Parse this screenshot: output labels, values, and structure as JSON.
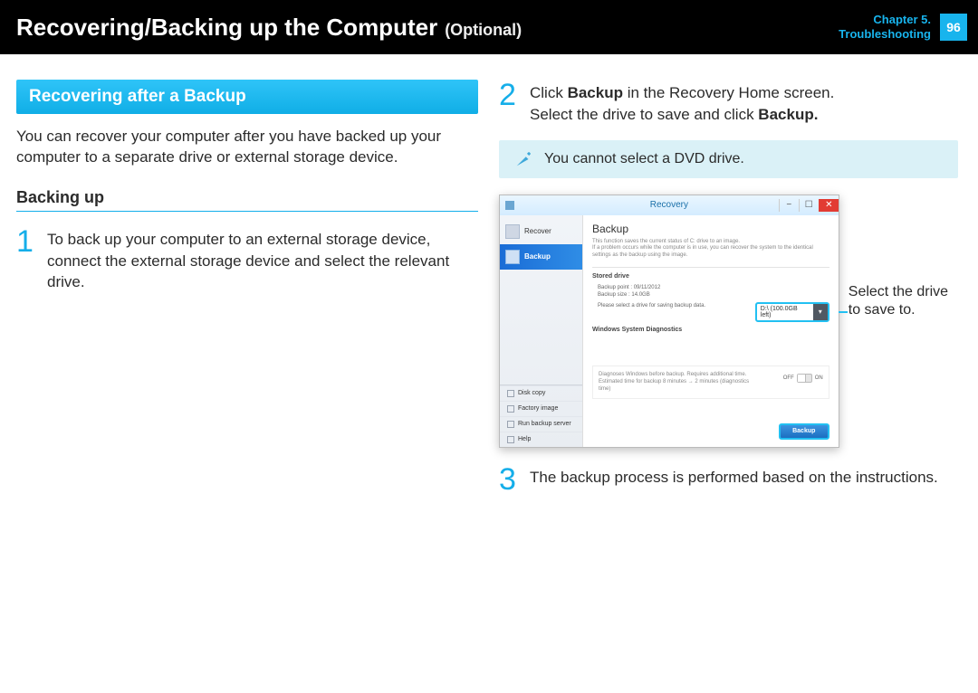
{
  "header": {
    "title_main": "Recovering/Backing up the Computer",
    "title_optional": "(Optional)",
    "chapter_line1": "Chapter 5.",
    "chapter_line2": "Troubleshooting",
    "page_number": "96"
  },
  "left": {
    "section_bar": "Recovering after a Backup",
    "intro": "You can recover your computer after you have backed up your computer to a separate drive or external storage device.",
    "subhead": "Backing up",
    "step1_num": "1",
    "step1_text": "To back up your computer to an external storage device, connect the external storage device and select the relevant drive."
  },
  "right": {
    "step2_num": "2",
    "step2_text_pre": "Click ",
    "step2_text_b1": "Backup",
    "step2_text_mid": " in the Recovery Home screen.\nSelect the drive to save and click ",
    "step2_text_b2": "Backup.",
    "note_text": "You cannot select a DVD drive.",
    "callout_label": "Select the drive to save to.",
    "step3_num": "3",
    "step3_text": "The backup process is performed based on the instructions."
  },
  "app": {
    "titlebar": "Recovery",
    "sidebar": {
      "items": [
        {
          "label": "Recover",
          "selected": false
        },
        {
          "label": "Backup",
          "selected": true
        }
      ],
      "bottom": [
        "Disk copy",
        "Factory image",
        "Run backup server",
        "Help"
      ]
    },
    "main": {
      "title": "Backup",
      "desc": "This function saves the current status of C: drive to an image.\nIf a problem occurs while the computer is in use, you can recover the system to the identical settings as the backup using the image.",
      "panel_stored": "Stored drive",
      "info_point": "Backup point : 09/11/2012",
      "info_size": "Backup size : 14.0GB",
      "info_select": "Please select a drive for saving backup data.",
      "drive_selected": "D:\\ (100.0GB left)",
      "diag_title": "Windows System Diagnostics",
      "diag_text": "Diagnoses Windows before backup. Requires additional time.\nEstimated time for backup 8 minutes → 2 minutes (diagnostics time)",
      "toggle_off": "OFF",
      "toggle_on": "ON",
      "backup_button": "Backup"
    }
  }
}
